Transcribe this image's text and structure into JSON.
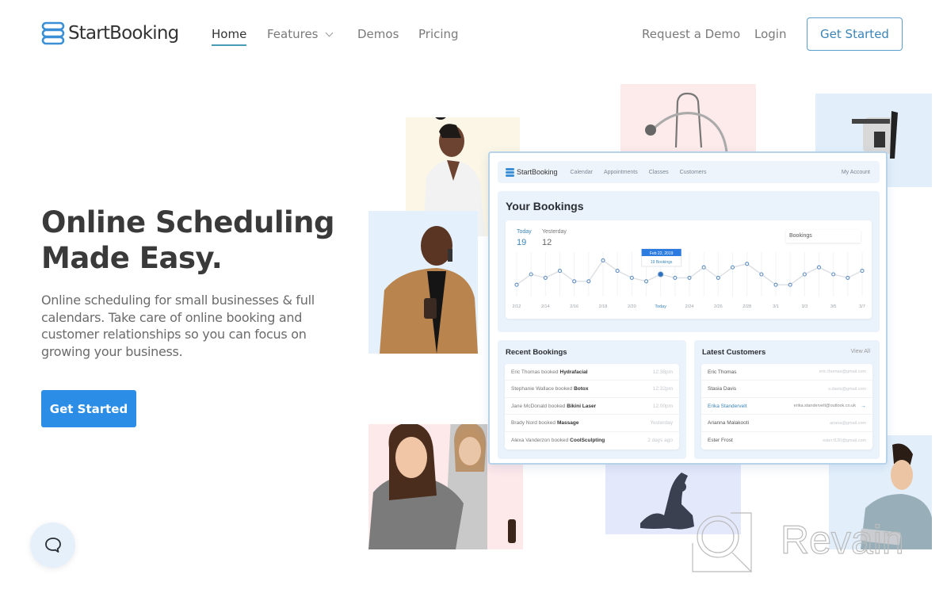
{
  "brand": {
    "name": "StartBooking",
    "accent": "#2c8de6",
    "outline_accent": "#3a84b8"
  },
  "nav": {
    "links": [
      {
        "label": "Home",
        "active": true
      },
      {
        "label": "Features",
        "has_dropdown": true
      },
      {
        "label": "Demos"
      },
      {
        "label": "Pricing"
      }
    ],
    "request_demo": "Request a Demo",
    "login": "Login",
    "get_started": "Get Started"
  },
  "hero": {
    "title_line1": "Online Scheduling",
    "title_line2": "Made Easy.",
    "description": "Online scheduling for small businesses & full calendars. Take care of online booking and customer relationships so you can focus on growing your business.",
    "cta": "Get Started"
  },
  "dashboard": {
    "logo": "StartBooking",
    "nav": [
      "Calendar",
      "Appointments",
      "Classes",
      "Customers"
    ],
    "account": "My Account",
    "title": "Your Bookings",
    "stats": [
      {
        "label": "Today",
        "value": "19"
      },
      {
        "label": "Yesterday",
        "value": "12"
      }
    ],
    "select": "Bookings",
    "tooltip": {
      "date": "Feb 22, 2019",
      "value": "19 Bookings"
    },
    "chart_data": {
      "type": "line",
      "x_tick_labels": [
        "2/12",
        "2/14",
        "2/16",
        "2/18",
        "2/20",
        "Today",
        "2/24",
        "2/26",
        "2/28",
        "3/1",
        "3/3",
        "3/5",
        "3/7"
      ],
      "values": [
        12,
        15,
        14,
        16,
        13,
        13,
        19,
        16,
        14,
        13,
        15,
        14,
        14,
        17,
        14,
        17,
        18,
        15,
        12,
        12,
        15,
        17,
        15,
        14,
        16
      ],
      "highlight_index": 10
    },
    "recent": {
      "title": "Recent Bookings",
      "items": [
        {
          "who": "Eric Thomas booked",
          "what": "Hydrafacial",
          "when": "12:38pm"
        },
        {
          "who": "Stephanie Wallace booked",
          "what": "Botox",
          "when": "12:32pm"
        },
        {
          "who": "Jane McDonald booked",
          "what": "Bikini Laser",
          "when": "12:00pm"
        },
        {
          "who": "Brady Nord booked",
          "what": "Massage",
          "when": "Yesterday"
        },
        {
          "who": "Alexa Vanderzon booked",
          "what": "CoolSculpting",
          "when": "2 days ago"
        }
      ]
    },
    "customers": {
      "title": "Latest Customers",
      "view_all": "View All",
      "items": [
        {
          "name": "Eric Thomas",
          "email": "eric.thomas@gmail.com"
        },
        {
          "name": "Stasia Davis",
          "email": "s.davis@gmail.com"
        },
        {
          "name": "Erika Standervelt",
          "email": "erika.standervelt@outlook.co.uk",
          "highlighted": true
        },
        {
          "name": "Arianna Malakooti",
          "email": "ariana@gmail.com"
        },
        {
          "name": "Ester Frost",
          "email": "ester.f120@gmail.com"
        }
      ]
    }
  },
  "watermark": "Revain"
}
